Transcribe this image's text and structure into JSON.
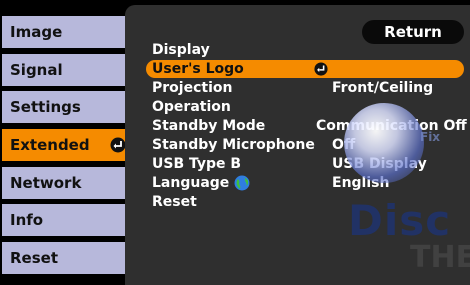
{
  "sidebar": {
    "items": [
      {
        "label": "Image",
        "active": false
      },
      {
        "label": "Signal",
        "active": false
      },
      {
        "label": "Settings",
        "active": false
      },
      {
        "label": "Extended",
        "active": true
      },
      {
        "label": "Network",
        "active": false
      },
      {
        "label": "Info",
        "active": false
      },
      {
        "label": "Reset",
        "active": false
      }
    ]
  },
  "panel": {
    "return_label": "Return",
    "rows": [
      {
        "label": "Display",
        "value": ""
      },
      {
        "label": "User's Logo",
        "value": ""
      },
      {
        "label": "Projection",
        "value": "Front/Ceiling"
      },
      {
        "label": "Operation",
        "value": ""
      },
      {
        "label": "Standby Mode",
        "value": "Communication Off"
      },
      {
        "label": "Standby Microphone",
        "value": "Off"
      },
      {
        "label": "USB Type B",
        "value": "USB Display"
      },
      {
        "label": "Language",
        "value": "English"
      },
      {
        "label": "Reset",
        "value": ""
      }
    ]
  },
  "watermark": {
    "word": "Disc",
    "sub": "THE",
    "tag": "Fix"
  },
  "colors": {
    "accent": "#f58b00",
    "sidebar_bg": "#b7b8db",
    "panel_bg": "#2f2f2f",
    "return_bg": "#0a0a0a"
  },
  "icons": {
    "enter": "enter-icon",
    "language": "globe-icon"
  }
}
